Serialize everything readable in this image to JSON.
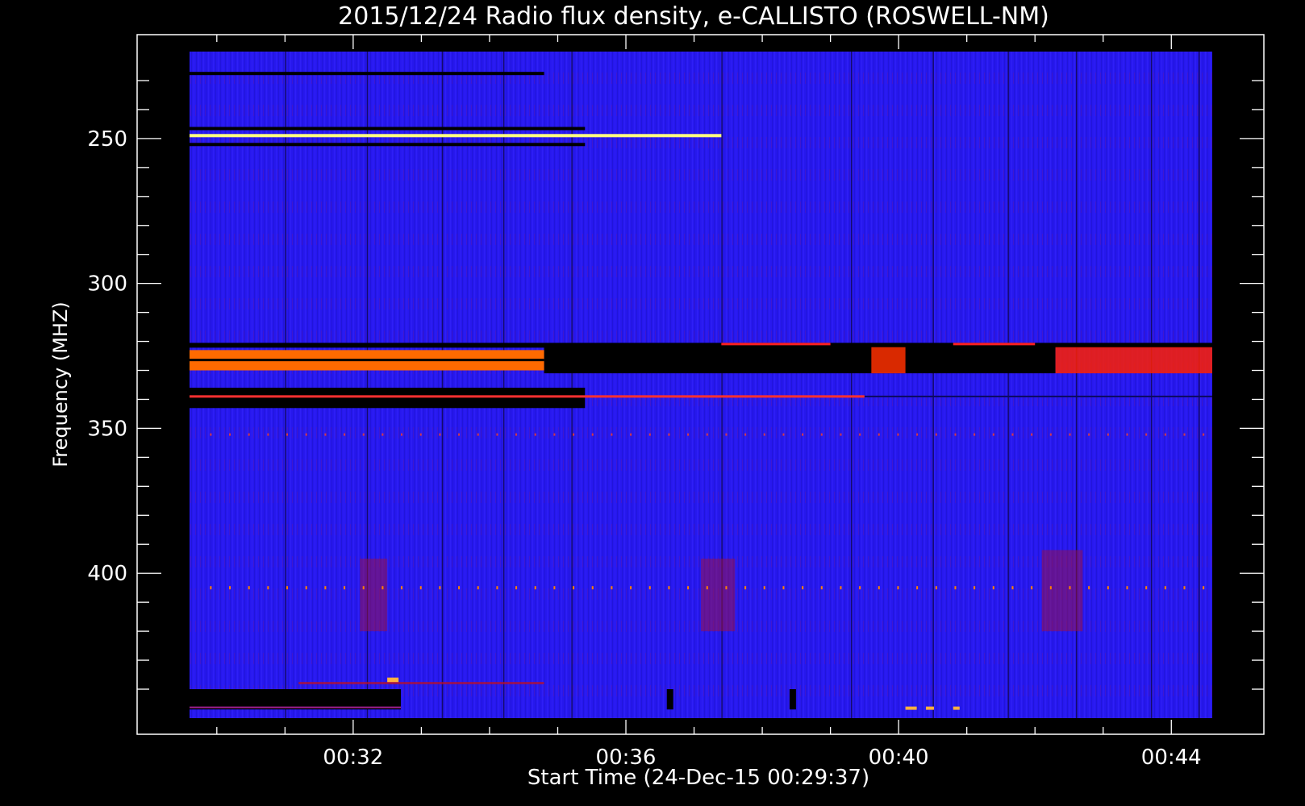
{
  "chart_data": {
    "type": "heatmap",
    "title": "2015/12/24  Radio flux density, e-CALLISTO (ROSWELL-NM)",
    "xlabel": "Start Time (24-Dec-15 00:29:37)",
    "ylabel": "Frequency (MHZ)",
    "x_tick_labels": [
      "00:32",
      "00:36",
      "00:40",
      "00:44"
    ],
    "x_tick_values_min": [
      32,
      36,
      40,
      44
    ],
    "y_tick_labels": [
      "250",
      "300",
      "350",
      "400"
    ],
    "y_tick_values": [
      250,
      300,
      350,
      400
    ],
    "xlim_min": [
      29.6,
      44.6
    ],
    "ylim": [
      220,
      450
    ],
    "y_inverted": true,
    "colormap": [
      "#000000",
      "#1010ff",
      "#ff0000",
      "#ffff00",
      "#ffffff"
    ],
    "background": "#2a1cf0",
    "features": [
      {
        "label": "continuous line",
        "freq": 249,
        "t_start": 29.6,
        "t_end": 37.4,
        "color": "#ffff80"
      },
      {
        "label": "bright band",
        "freq_range": [
          323,
          330
        ],
        "t_start": 29.6,
        "t_end": 34.8,
        "color": "#ff6a00"
      },
      {
        "label": "line",
        "freq": 339,
        "t_start": 29.6,
        "t_end": 39.5,
        "color": "#ff3030"
      },
      {
        "label": "dark band",
        "freq_range": [
          321,
          331
        ],
        "t_start": 34.8,
        "t_end": 42.3,
        "color": "#000000"
      },
      {
        "label": "intermittent band",
        "freq_range": [
          322,
          331
        ],
        "t_start": 42.3,
        "t_end": 44.6,
        "color": "#ff2000"
      },
      {
        "label": "periodic dots",
        "freq": 405,
        "color": "#ff8000"
      }
    ]
  }
}
